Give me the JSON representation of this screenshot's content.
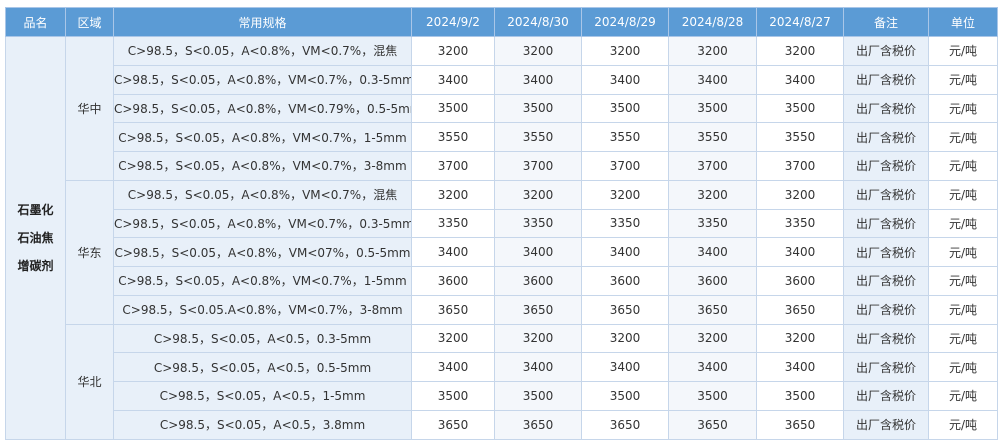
{
  "headers": {
    "product": "品名",
    "region": "区域",
    "spec": "常用规格",
    "dates": [
      "2024/9/2",
      "2024/8/30",
      "2024/8/29",
      "2024/8/28",
      "2024/8/27"
    ],
    "note": "备注",
    "unit": "单位"
  },
  "product_lines": [
    "石墨化",
    "石油焦",
    "增碳剂"
  ],
  "note_text": "出厂含税价",
  "unit_text": "元/吨",
  "regions": [
    "华中",
    "华东",
    "华北"
  ],
  "rows": [
    {
      "spec": "C>98.5，S<0.05，A<0.8%，VM<0.7%，混焦",
      "prices": [
        "3200",
        "3200",
        "3200",
        "3200",
        "3200"
      ],
      "note": "出厂含税价",
      "unit": "元/吨"
    },
    {
      "spec": "C>98.5，S<0.05，A<0.8%，VM<0.7%，0.3-5mm",
      "prices": [
        "3400",
        "3400",
        "3400",
        "3400",
        "3400"
      ],
      "note": "出厂含税价",
      "unit": "元/吨"
    },
    {
      "spec": "C>98.5，S<0.05，A<0.8%，VM<0.79%，0.5-5mm",
      "prices": [
        "3500",
        "3500",
        "3500",
        "3500",
        "3500"
      ],
      "note": "出厂含税价",
      "unit": "元/吨"
    },
    {
      "spec": "C>98.5，S<0.05，A<0.8%，VM<0.7%，1-5mm",
      "prices": [
        "3550",
        "3550",
        "3550",
        "3550",
        "3550"
      ],
      "note": "出厂含税价",
      "unit": "元/吨"
    },
    {
      "spec": "C>98.5，S<0.05，A<0.8%，VM<0.7%，3-8mm",
      "prices": [
        "3700",
        "3700",
        "3700",
        "3700",
        "3700"
      ],
      "note": "出厂含税价",
      "unit": "元/吨"
    },
    {
      "spec": "C>98.5，S<0.05，A<0.8%，VM<0.7%，混焦",
      "prices": [
        "3200",
        "3200",
        "3200",
        "3200",
        "3200"
      ],
      "note": "出厂含税价",
      "unit": "元/吨"
    },
    {
      "spec": "C>98.5，S<0.05，A<0.8%，VM<0.7%，0.3-5mm",
      "prices": [
        "3350",
        "3350",
        "3350",
        "3350",
        "3350"
      ],
      "note": "出厂含税价",
      "unit": "元/吨"
    },
    {
      "spec": "C>98.5，S<0.05，A<0.8%，VM<07%，0.5-5mm",
      "prices": [
        "3400",
        "3400",
        "3400",
        "3400",
        "3400"
      ],
      "note": "出厂含税价",
      "unit": "元/吨"
    },
    {
      "spec": "C>98.5，S<0.05，A<0.8%，VM<0.7%，1-5mm",
      "prices": [
        "3600",
        "3600",
        "3600",
        "3600",
        "3600"
      ],
      "note": "出厂含税价",
      "unit": "元/吨"
    },
    {
      "spec": "C>98.5，S<0.05.A<0.8%，VM<0.7%，3-8mm",
      "prices": [
        "3650",
        "3650",
        "3650",
        "3650",
        "3650"
      ],
      "note": "出厂含税价",
      "unit": "元/吨"
    },
    {
      "spec": "C>98.5，S<0.05，A<0.5，0.3-5mm",
      "prices": [
        "3200",
        "3200",
        "3200",
        "3200",
        "3200"
      ],
      "note": "出厂含税价",
      "unit": "元/吨"
    },
    {
      "spec": "C>98.5，S<0.05，A<0.5，0.5-5mm",
      "prices": [
        "3400",
        "3400",
        "3400",
        "3400",
        "3400"
      ],
      "note": "出厂含税价",
      "unit": "元/吨"
    },
    {
      "spec": "C>98.5，S<0.05，A<0.5，1-5mm",
      "prices": [
        "3500",
        "3500",
        "3500",
        "3500",
        "3500"
      ],
      "note": "出厂含税价",
      "unit": "元/吨"
    },
    {
      "spec": "C>98.5，S<0.05，A<0.5，3.8mm",
      "prices": [
        "3650",
        "3650",
        "3650",
        "3650",
        "3650"
      ],
      "note": "出厂含税价",
      "unit": "元/吨"
    }
  ],
  "colors": {
    "header_bg": "#5b9bd5",
    "label_bg": "#e8f0f9",
    "border": "#c6d6ea",
    "text": "#333333"
  }
}
